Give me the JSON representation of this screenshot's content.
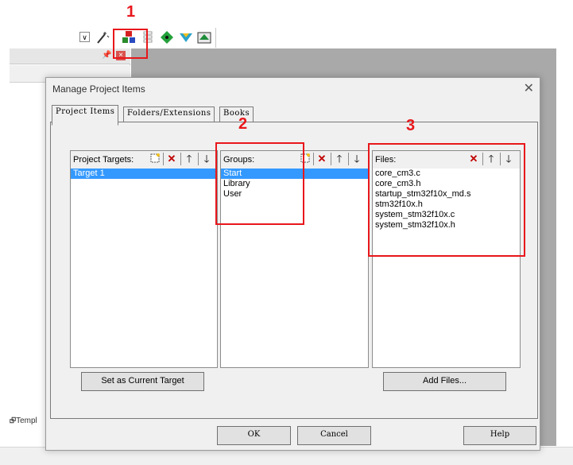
{
  "annotations": [
    "1",
    "2",
    "3"
  ],
  "background": {
    "bottom_tab_label": "Templ"
  },
  "dialog": {
    "title": "Manage Project Items",
    "tabs": [
      {
        "label": "Project Items",
        "active": true
      },
      {
        "label": "Folders/Extensions",
        "active": false
      },
      {
        "label": "Books",
        "active": false
      }
    ],
    "targets": {
      "label": "Project Targets:",
      "items": [
        "Target 1"
      ],
      "selected": 0,
      "button": "Set as Current Target"
    },
    "groups": {
      "label": "Groups:",
      "items": [
        "Start",
        "Library",
        "User"
      ],
      "selected": 0
    },
    "files": {
      "label": "Files:",
      "items": [
        "core_cm3.c",
        "core_cm3.h",
        "startup_stm32f10x_md.s",
        "stm32f10x.h",
        "system_stm32f10x.c",
        "system_stm32f10x.h"
      ],
      "button": "Add Files..."
    },
    "buttons": {
      "ok": "OK",
      "cancel": "Cancel",
      "help": "Help"
    }
  },
  "colors": {
    "annotation": "#e8171b",
    "selection": "#3399ff"
  }
}
